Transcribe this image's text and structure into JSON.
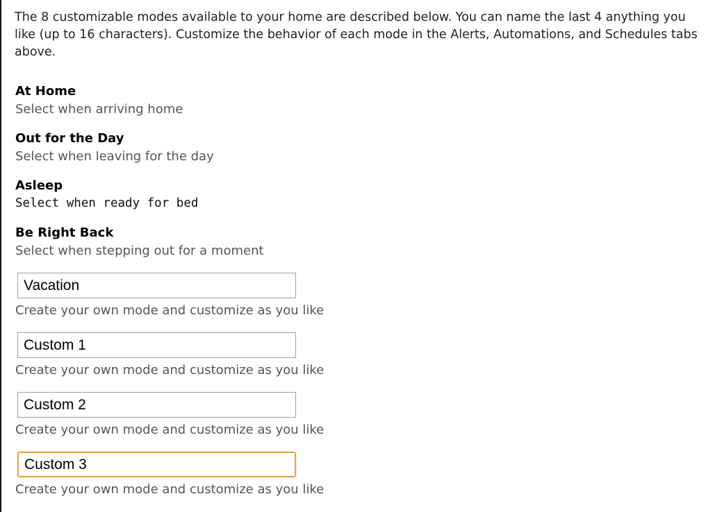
{
  "intro_text": "The 8 customizable modes available to your home are described below. You can name the last 4 anything you like (up to 16 characters). Customize the behavior of each mode in the Alerts, Automations, and Schedules tabs above.",
  "fixed_modes": [
    {
      "title": "At Home",
      "description": "Select when arriving home"
    },
    {
      "title": "Out for the Day",
      "description": "Select when leaving for the day"
    },
    {
      "title": "Asleep",
      "description": "Select when ready for bed"
    },
    {
      "title": "Be Right Back",
      "description": "Select when stepping out for a moment"
    }
  ],
  "custom_modes": [
    {
      "value": "Vacation",
      "description": "Create your own mode and customize as you like"
    },
    {
      "value": "Custom 1",
      "description": "Create your own mode and customize as you like"
    },
    {
      "value": "Custom 2",
      "description": "Create your own mode and customize as you like"
    },
    {
      "value": "Custom 3",
      "description": "Create your own mode and customize as you like"
    }
  ],
  "colors": {
    "focus_border": "#e0a84e",
    "description_text": "#555555"
  }
}
